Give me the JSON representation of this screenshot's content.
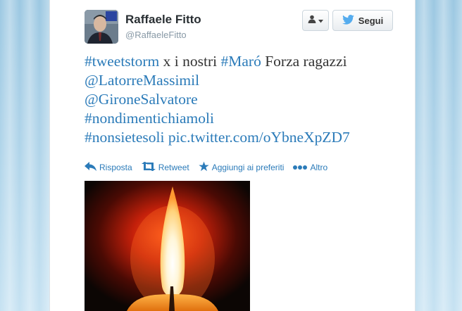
{
  "user": {
    "name": "Raffaele Fitto",
    "handle": "@RaffaeleFitto"
  },
  "follow_button": {
    "label": "Segui"
  },
  "tweet": {
    "line1": {
      "hashtag1": "#tweetstorm",
      "text1": " x i nostri ",
      "hashtag2": "#Maró",
      "text2": " Forza ragazzi"
    },
    "mention1": "@LatorreMassimil",
    "mention2": "@GironeSalvatore",
    "hashtag3": "#nondimentichiamoli",
    "line5": {
      "hashtag4": "#nonsietesoli",
      "link": " pic.twitter.com/oYbneXpZD7"
    }
  },
  "actions": {
    "reply": "Risposta",
    "retweet": "Retweet",
    "favorite": "Aggiungi ai preferiti",
    "more": "Altro"
  },
  "colors": {
    "link": "#2b7bb9",
    "text": "#333333",
    "muted": "#8899a6",
    "twitter_blue": "#55acee"
  },
  "icons": {
    "reply": "reply-arrow-icon",
    "retweet": "retweet-icon",
    "favorite": "star-icon",
    "more": "ellipsis-icon",
    "follow": "twitter-bird-icon",
    "user_menu": "user-dropdown-icon"
  }
}
